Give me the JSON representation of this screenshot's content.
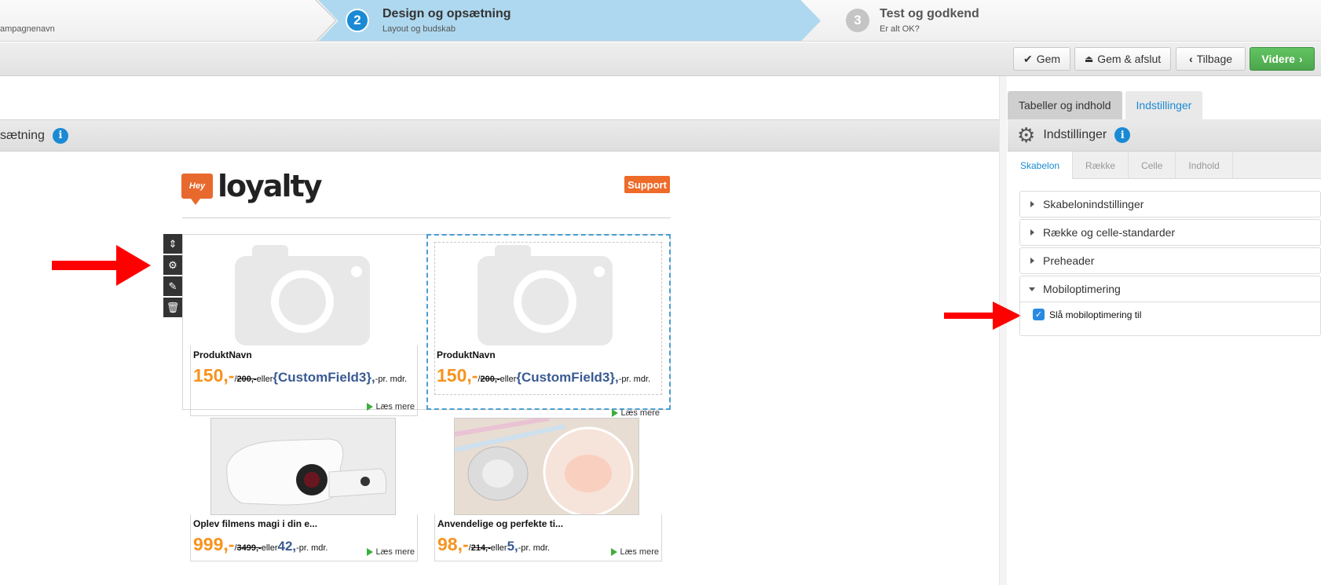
{
  "wizard": {
    "step1_sub": "ampagnenavn",
    "step2": {
      "num": "2",
      "title": "Design og opsætning",
      "sub": "Layout og budskab"
    },
    "step3": {
      "num": "3",
      "title": "Test og godkend",
      "sub": "Er alt OK?"
    }
  },
  "toolbar": {
    "save": "Gem",
    "save_exit": "Gem & afslut",
    "back": "Tilbage",
    "next": "Videre"
  },
  "left": {
    "header_title": "sætning"
  },
  "email": {
    "logo_badge": "Hey",
    "logo_text": "loyalty",
    "support": "Support",
    "row_tools": [
      "move-icon",
      "gear-icon",
      "pencil-icon",
      "trash-icon"
    ],
    "products": [
      {
        "name": "ProduktNavn",
        "price": "150,-",
        "slash": "/",
        "old": "200,-",
        "eller": "eller",
        "monthly": "{CustomField3},",
        "mdr": "-pr. mdr.",
        "link": "Læs mere"
      },
      {
        "name": "ProduktNavn",
        "price": "150,-",
        "slash": "/",
        "old": "200,-",
        "eller": "eller",
        "monthly": "{CustomField3},",
        "mdr": "-pr. mdr.",
        "link": "Læs mere"
      },
      {
        "name": "Oplev filmens magi i din e...",
        "price": "999,-",
        "slash": "/",
        "old": "3499,-",
        "eller": "eller",
        "monthly": "42,",
        "mdr": "-pr. mdr.",
        "link": "Læs mere"
      },
      {
        "name": "Anvendelige og perfekte ti...",
        "price": "98,-",
        "slash": "/",
        "old": "214,-",
        "eller": "eller",
        "monthly": "5,",
        "mdr": "-pr. mdr.",
        "link": "Læs mere"
      }
    ]
  },
  "right": {
    "tabs": [
      "Tabeller og indhold",
      "Indstillinger"
    ],
    "header_title": "Indstillinger",
    "sub_tabs": [
      "Skabelon",
      "Række",
      "Celle",
      "Indhold"
    ],
    "accordion": [
      "Skabelonindstillinger",
      "Række og celle-standarder",
      "Preheader",
      "Mobiloptimering"
    ],
    "checkbox_label": "Slå mobiloptimering til"
  },
  "colors": {
    "accent": "#1a8ad4",
    "green": "#4ca64c",
    "orange": "#f7931e",
    "arrow": "#ff0000"
  }
}
